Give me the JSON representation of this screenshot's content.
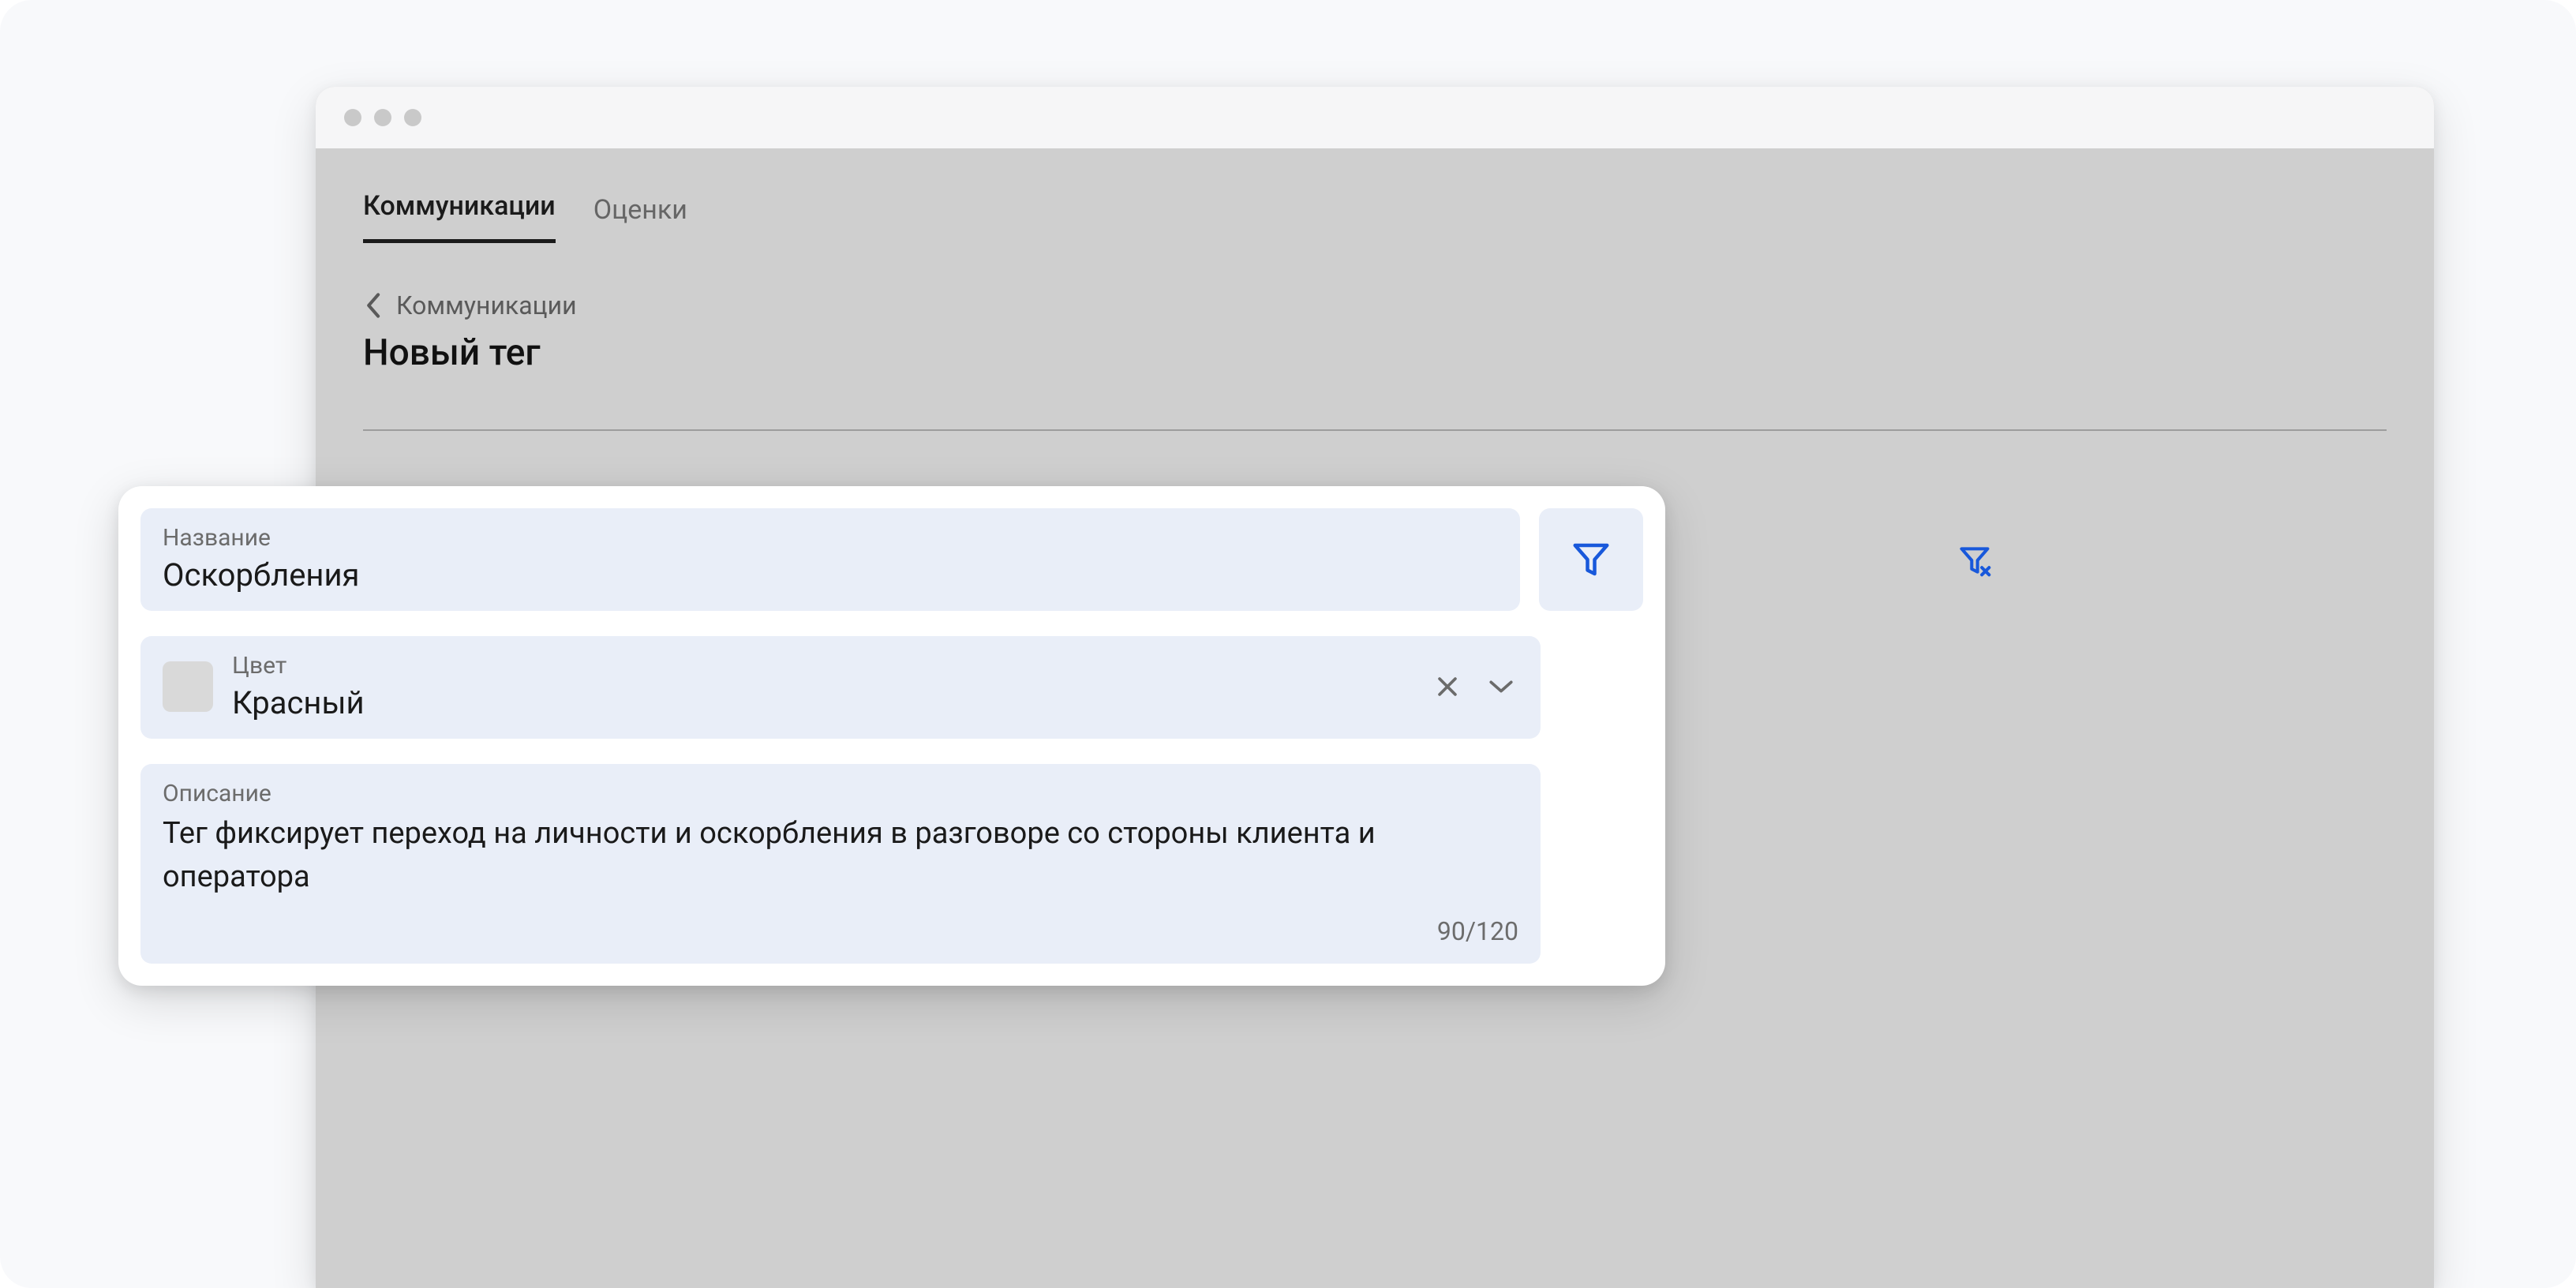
{
  "tabs": {
    "communications": "Коммуникации",
    "ratings": "Оценки"
  },
  "breadcrumb": {
    "back_label": "Коммуникации"
  },
  "page": {
    "title": "Новый тег"
  },
  "modal": {
    "name": {
      "label": "Название",
      "value": "Оскорбления"
    },
    "color": {
      "label": "Цвет",
      "value": "Красный"
    },
    "description": {
      "label": "Описание",
      "value": "Тег фиксирует переход на личности и оскорбления в разговоре со стороны клиента и оператора",
      "counter": "90/120"
    }
  },
  "icons": {
    "filter": "filter-icon",
    "filter_clear": "filter-clear-icon",
    "close": "close-icon",
    "chevron_down": "chevron-down-icon",
    "chevron_left": "chevron-left-icon"
  },
  "colors": {
    "accent": "#1858db",
    "field_bg": "#e9eef8"
  }
}
